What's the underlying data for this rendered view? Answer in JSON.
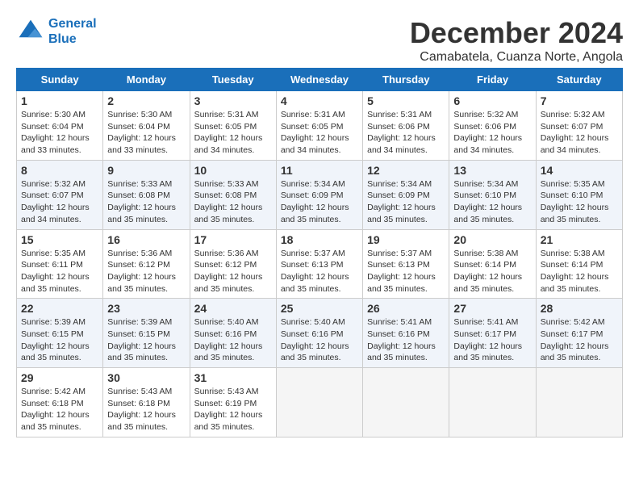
{
  "logo": {
    "line1": "General",
    "line2": "Blue"
  },
  "title": "December 2024",
  "subtitle": "Camabatela, Cuanza Norte, Angola",
  "header": {
    "accent_color": "#1a6fba"
  },
  "days_of_week": [
    "Sunday",
    "Monday",
    "Tuesday",
    "Wednesday",
    "Thursday",
    "Friday",
    "Saturday"
  ],
  "weeks": [
    [
      {
        "day": "1",
        "sunrise": "5:30 AM",
        "sunset": "6:04 PM",
        "daylight": "12 hours and 33 minutes."
      },
      {
        "day": "2",
        "sunrise": "5:30 AM",
        "sunset": "6:04 PM",
        "daylight": "12 hours and 33 minutes."
      },
      {
        "day": "3",
        "sunrise": "5:31 AM",
        "sunset": "6:05 PM",
        "daylight": "12 hours and 34 minutes."
      },
      {
        "day": "4",
        "sunrise": "5:31 AM",
        "sunset": "6:05 PM",
        "daylight": "12 hours and 34 minutes."
      },
      {
        "day": "5",
        "sunrise": "5:31 AM",
        "sunset": "6:06 PM",
        "daylight": "12 hours and 34 minutes."
      },
      {
        "day": "6",
        "sunrise": "5:32 AM",
        "sunset": "6:06 PM",
        "daylight": "12 hours and 34 minutes."
      },
      {
        "day": "7",
        "sunrise": "5:32 AM",
        "sunset": "6:07 PM",
        "daylight": "12 hours and 34 minutes."
      }
    ],
    [
      {
        "day": "8",
        "sunrise": "5:32 AM",
        "sunset": "6:07 PM",
        "daylight": "12 hours and 34 minutes."
      },
      {
        "day": "9",
        "sunrise": "5:33 AM",
        "sunset": "6:08 PM",
        "daylight": "12 hours and 35 minutes."
      },
      {
        "day": "10",
        "sunrise": "5:33 AM",
        "sunset": "6:08 PM",
        "daylight": "12 hours and 35 minutes."
      },
      {
        "day": "11",
        "sunrise": "5:34 AM",
        "sunset": "6:09 PM",
        "daylight": "12 hours and 35 minutes."
      },
      {
        "day": "12",
        "sunrise": "5:34 AM",
        "sunset": "6:09 PM",
        "daylight": "12 hours and 35 minutes."
      },
      {
        "day": "13",
        "sunrise": "5:34 AM",
        "sunset": "6:10 PM",
        "daylight": "12 hours and 35 minutes."
      },
      {
        "day": "14",
        "sunrise": "5:35 AM",
        "sunset": "6:10 PM",
        "daylight": "12 hours and 35 minutes."
      }
    ],
    [
      {
        "day": "15",
        "sunrise": "5:35 AM",
        "sunset": "6:11 PM",
        "daylight": "12 hours and 35 minutes."
      },
      {
        "day": "16",
        "sunrise": "5:36 AM",
        "sunset": "6:12 PM",
        "daylight": "12 hours and 35 minutes."
      },
      {
        "day": "17",
        "sunrise": "5:36 AM",
        "sunset": "6:12 PM",
        "daylight": "12 hours and 35 minutes."
      },
      {
        "day": "18",
        "sunrise": "5:37 AM",
        "sunset": "6:13 PM",
        "daylight": "12 hours and 35 minutes."
      },
      {
        "day": "19",
        "sunrise": "5:37 AM",
        "sunset": "6:13 PM",
        "daylight": "12 hours and 35 minutes."
      },
      {
        "day": "20",
        "sunrise": "5:38 AM",
        "sunset": "6:14 PM",
        "daylight": "12 hours and 35 minutes."
      },
      {
        "day": "21",
        "sunrise": "5:38 AM",
        "sunset": "6:14 PM",
        "daylight": "12 hours and 35 minutes."
      }
    ],
    [
      {
        "day": "22",
        "sunrise": "5:39 AM",
        "sunset": "6:15 PM",
        "daylight": "12 hours and 35 minutes."
      },
      {
        "day": "23",
        "sunrise": "5:39 AM",
        "sunset": "6:15 PM",
        "daylight": "12 hours and 35 minutes."
      },
      {
        "day": "24",
        "sunrise": "5:40 AM",
        "sunset": "6:16 PM",
        "daylight": "12 hours and 35 minutes."
      },
      {
        "day": "25",
        "sunrise": "5:40 AM",
        "sunset": "6:16 PM",
        "daylight": "12 hours and 35 minutes."
      },
      {
        "day": "26",
        "sunrise": "5:41 AM",
        "sunset": "6:16 PM",
        "daylight": "12 hours and 35 minutes."
      },
      {
        "day": "27",
        "sunrise": "5:41 AM",
        "sunset": "6:17 PM",
        "daylight": "12 hours and 35 minutes."
      },
      {
        "day": "28",
        "sunrise": "5:42 AM",
        "sunset": "6:17 PM",
        "daylight": "12 hours and 35 minutes."
      }
    ],
    [
      {
        "day": "29",
        "sunrise": "5:42 AM",
        "sunset": "6:18 PM",
        "daylight": "12 hours and 35 minutes."
      },
      {
        "day": "30",
        "sunrise": "5:43 AM",
        "sunset": "6:18 PM",
        "daylight": "12 hours and 35 minutes."
      },
      {
        "day": "31",
        "sunrise": "5:43 AM",
        "sunset": "6:19 PM",
        "daylight": "12 hours and 35 minutes."
      },
      null,
      null,
      null,
      null
    ]
  ]
}
